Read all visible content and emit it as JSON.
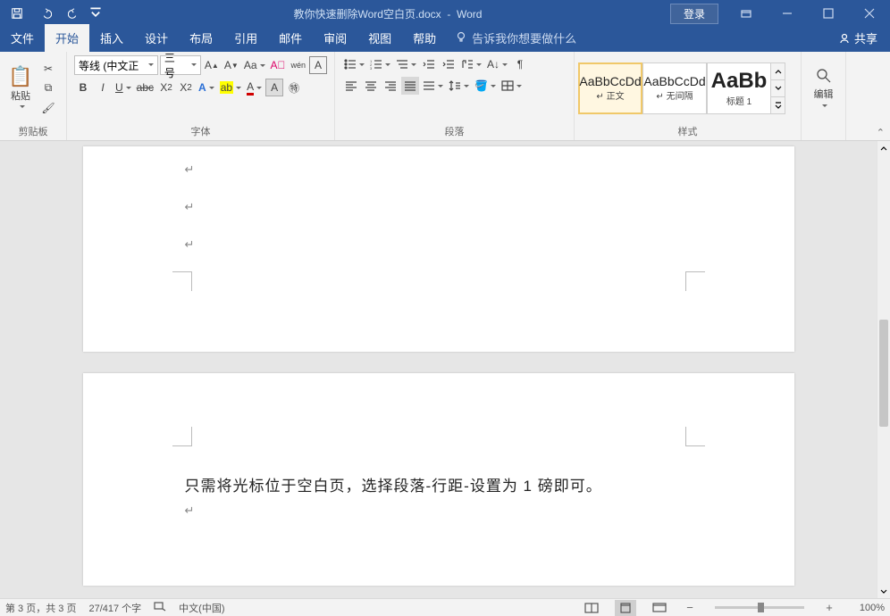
{
  "titlebar": {
    "doc_name": "教你快速删除Word空白页.docx",
    "app_name": "Word",
    "login": "登录"
  },
  "tabs": {
    "file": "文件",
    "home": "开始",
    "insert": "插入",
    "design": "设计",
    "layout": "布局",
    "references": "引用",
    "mailings": "邮件",
    "review": "审阅",
    "view": "视图",
    "help": "帮助",
    "tell_me": "告诉我你想要做什么",
    "share": "共享"
  },
  "ribbon": {
    "clipboard": {
      "label": "剪贴板",
      "paste": "粘贴"
    },
    "font": {
      "label": "字体",
      "family": "等线 (中文正",
      "size": "三号",
      "aa": "Aa",
      "wen": "wén",
      "b": "B",
      "i": "I",
      "u": "U",
      "abc": "abc",
      "x2": "X₂",
      "x2s": "X²",
      "a_outline": "A",
      "pen": "A",
      "a_color": "A",
      "a_circle": "A"
    },
    "paragraph": {
      "label": "段落"
    },
    "styles": {
      "label": "样式",
      "items": [
        {
          "preview": "AaBbCcDd",
          "name": "↵ 正文"
        },
        {
          "preview": "AaBbCcDd",
          "name": "↵ 无间隔"
        },
        {
          "preview": "AaBb",
          "name": "标题 1"
        }
      ]
    },
    "editing": {
      "label": "编辑"
    }
  },
  "document": {
    "para_mark": "↵",
    "body_text": "只需将光标位于空白页，选择段落-行距-设置为 1 磅即可。"
  },
  "status": {
    "page": "第 3 页，共 3 页",
    "words": "27/417 个字",
    "lang_ind": "",
    "lang": "中文(中国)",
    "zoom": "100%"
  }
}
